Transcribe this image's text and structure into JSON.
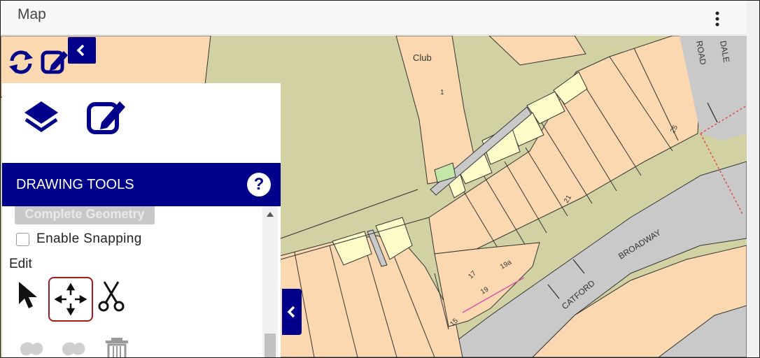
{
  "window": {
    "title": "Map",
    "menu_icon": "more-vertical-icon"
  },
  "toolbar": {
    "refresh_icon": "refresh-icon",
    "edit_icon": "edit-icon",
    "collapse_icon": "chevron-left-icon"
  },
  "panel": {
    "layers_icon": "layers-icon",
    "edit_icon": "edit-icon",
    "header_title": "DRAWING TOOLS",
    "help_label": "?",
    "complete_geometry_label": "Complete Geometry",
    "snapping_label": "Enable Snapping",
    "snapping_checked": false,
    "edit_section_label": "Edit",
    "edit_tools": [
      "select-arrow-icon",
      "move-icon",
      "scissors-icon"
    ],
    "active_edit_tool": "move-icon",
    "more_tools": [
      "union-icon",
      "reshape-icon",
      "trash-icon"
    ]
  },
  "map": {
    "labels": {
      "club": "Club",
      "road_top": "ROAD",
      "road_top_right": "DALE",
      "catford": "CATFORD",
      "broadway": "BROADWAY",
      "num_25": "25",
      "num_21": "21",
      "num_17": "17",
      "num_19": "19",
      "num_19a": "19a",
      "num_15": "15",
      "num_1": "1"
    },
    "colors": {
      "building": "#fcd8b1",
      "open_land": "#d2d1a3",
      "road": "#c9c9c9",
      "small_building": "#fefcc9",
      "grass": "#c4e6a9",
      "boundary_dotted": "#e84848",
      "parcel_pink": "#d454a8"
    }
  },
  "colors": {
    "accent": "#00008b",
    "selected_border": "#a11d1d"
  }
}
